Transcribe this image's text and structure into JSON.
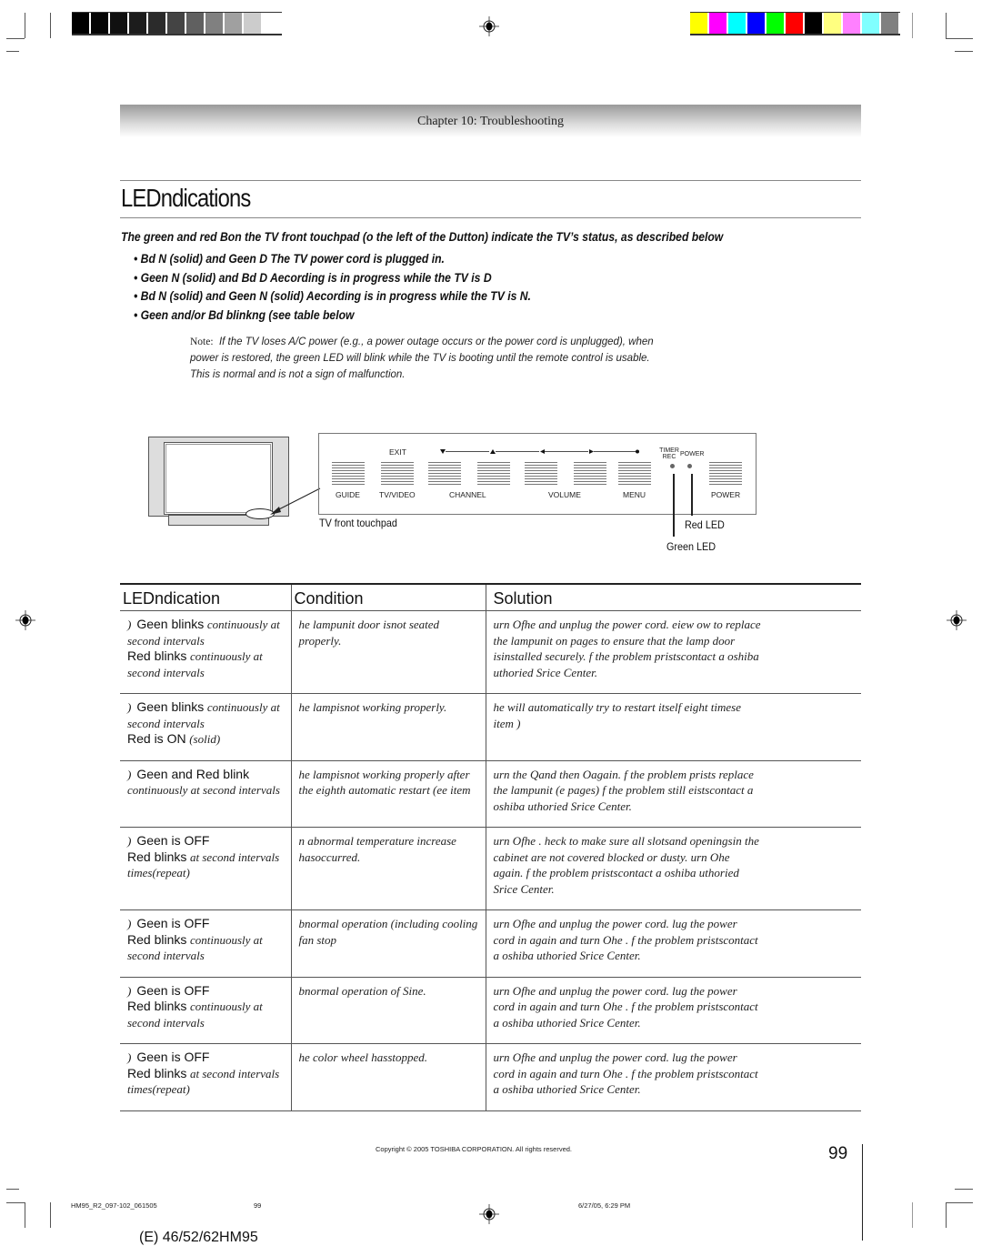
{
  "print_marks": {
    "grayscale_bar": [
      "#000000",
      "#050505",
      "#101010",
      "#1c1c1c",
      "#2b2b2b",
      "#444444",
      "#606060",
      "#808080",
      "#a0a0a0",
      "#cccccc",
      "#ffffff"
    ],
    "color_bar": [
      "#ffff00",
      "#ff00ff",
      "#00ffff",
      "#0000ff",
      "#00ff00",
      "#ff0000",
      "#000000",
      "#ffff80",
      "#ff80ff",
      "#80ffff",
      "#808080"
    ]
  },
  "header": {
    "chapter": "Chapter 10: Troubleshooting"
  },
  "page_title": "LEDndications",
  "intro": "The green and red Bon the TV front touchpad (o the left of the Dutton) indicate the TV’s status, as described below",
  "bullets": [
    "• Bd N (solid) and Geen D The TV power cord is plugged in.",
    "• Geen N (solid) and Bd D Aecording is in progress while the TV is D",
    "• Bd N (solid) and Geen N (solid)  Aecording is in progress while the TV is N.",
    "• Geen and/or Bd blinkng (see table below"
  ],
  "note": {
    "label": "Note:",
    "text": "If the TV loses A/C power (e.g., a power outage occurs or the power cord is unplugged), when power is restored, the green LED will blink while the TV is booting until the remote control is usable. This is normal and is not a sign of malfunction."
  },
  "diagram": {
    "caption": "TV front touchpad",
    "exit_label": "EXIT",
    "buttons": [
      "GUIDE",
      "TV/VIDEO",
      "CHANNEL",
      "VOLUME",
      "MENU",
      "POWER"
    ],
    "led_labels": {
      "timer": "TIMER REC",
      "power": "POWER"
    },
    "red_led": "Red LED",
    "green_led": "Green LED"
  },
  "table": {
    "headers": [
      "LEDndication",
      "Condition",
      "Solution"
    ],
    "rows": [
      {
        "ind_main": "Geen blinks",
        "ind_sub": "continuously at second intervals",
        "ind_main2": "Red blinks",
        "ind_sub2": "continuously at second intervals",
        "condition": "he lampunit door isnot seated properly.",
        "solution": "urn Ofhe and unplug the power cord. eiew ow to replace the lampunit on pages to ensure that the lamp door isinstalled securely. f the problem pristscontact a oshiba uthoried Srice Center."
      },
      {
        "ind_main": "Geen blinks",
        "ind_sub": "continuously at second intervals",
        "ind_main2": "Red is ON",
        "ind_sub2": "(solid)",
        "condition": "he lampisnot working properly.",
        "solution": "he will automatically try to restart itself eight timese item )"
      },
      {
        "ind_main": "Geen and Red blink",
        "ind_sub": "continuously at second intervals",
        "ind_main2": "",
        "ind_sub2": "",
        "condition": "he lampisnot working properly after the eighth automatic restart (ee item",
        "solution": "urn the Qand then Oagain. f the problem prists replace the lampunit (e pages) f the problem still eistscontact a oshiba uthoried Srice Center."
      },
      {
        "ind_main": "Geen is OFF",
        "ind_sub": "",
        "ind_main2": "Red blinks",
        "ind_sub2": "at second intervals times(repeat)",
        "condition": "n abnormal temperature increase hasoccurred.",
        "solution": "urn Ofhe . heck to make sure all slotsand openingsin the cabinet are not covered blocked or dusty. urn Ohe again. f the problem pristscontact a oshiba uthoried Srice Center."
      },
      {
        "ind_main": "Geen is OFF",
        "ind_sub": "",
        "ind_main2": "Red blinks",
        "ind_sub2": "continuously at second intervals",
        "condition": "bnormal operation (including cooling fan stop",
        "solution": "urn Ofhe and unplug the power cord. lug the power cord in again and turn Ohe . f the problem pristscontact a oshiba uthoried Srice Center."
      },
      {
        "ind_main": "Geen is OFF",
        "ind_sub": "",
        "ind_main2": "Red blinks",
        "ind_sub2": "continuously at second intervals",
        "condition": "bnormal operation of Sine.",
        "solution": "urn Ofhe and unplug the power cord. lug the power cord in again and turn Ohe . f the problem pristscontact a oshiba uthoried Srice Center."
      },
      {
        "ind_main": "Geen is OFF",
        "ind_sub": "",
        "ind_main2": "Red blinks",
        "ind_sub2": "at second intervals times(repeat)",
        "condition": "he color wheel hasstopped.",
        "solution": "urn Ofhe and unplug the power cord. lug the power cord in again and turn Ohe . f the problem pristscontact a oshiba uthoried Srice Center."
      }
    ]
  },
  "footer": {
    "copyright": "Copyright © 2005 TOSHIBA CORPORATION. All rights reserved.",
    "page_number": "99",
    "slug_file": "HM95_R2_097-102_061505",
    "slug_page": "99",
    "slug_date": "6/27/05, 6:29 PM",
    "model": "(E) 46/52/62HM95"
  }
}
